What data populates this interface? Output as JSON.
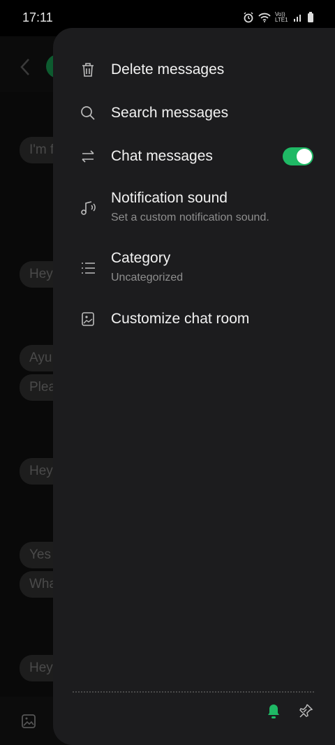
{
  "status_bar": {
    "time": "17:11",
    "network_label": "Vo)) LTE1"
  },
  "chat_background": {
    "bubbles": [
      "I'm f",
      "Hey",
      "Ayu",
      "Plea",
      "Hey",
      "Yes",
      "Wha",
      "Hey"
    ]
  },
  "drawer": {
    "items": [
      {
        "title": "Delete messages",
        "icon": "trash-icon"
      },
      {
        "title": "Search messages",
        "icon": "search-icon"
      },
      {
        "title": "Chat messages",
        "icon": "swap-arrows-icon",
        "toggle_on": true
      },
      {
        "title": "Notification sound",
        "subtitle": "Set a custom notification sound.",
        "icon": "music-note-icon"
      },
      {
        "title": "Category",
        "subtitle": "Uncategorized",
        "icon": "list-icon"
      },
      {
        "title": "Customize chat room",
        "icon": "image-icon"
      }
    ],
    "footer": {
      "bell_icon": "bell-icon",
      "pin_icon": "pin-icon"
    }
  },
  "colors": {
    "accent": "#1fb965",
    "drawer_bg": "#1c1c1e"
  }
}
